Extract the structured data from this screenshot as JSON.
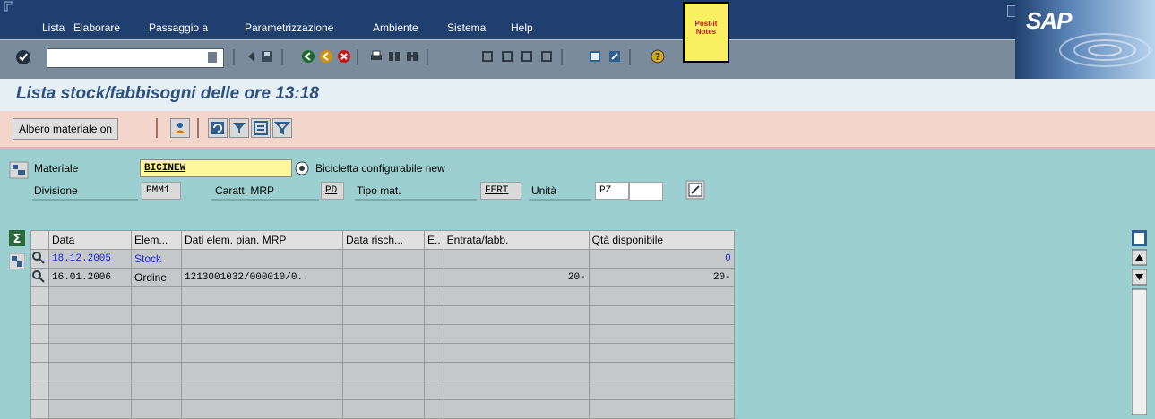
{
  "menu": {
    "items": [
      {
        "label": "Lista"
      },
      {
        "label": "Elaborare"
      },
      {
        "label": "Passaggio a"
      },
      {
        "label": "Parametrizzazione"
      },
      {
        "label": "Ambiente"
      },
      {
        "label": "Sistema"
      },
      {
        "label": "Help"
      }
    ]
  },
  "sap_logo_text": "SAP",
  "postit_label": "Post-it Notes",
  "page_title": "Lista stock/fabbisogni delle ore 13:18",
  "app_toolbar": {
    "albero_label": "Albero materiale on"
  },
  "header": {
    "materiale_label": "Materiale",
    "materiale_value": "BICINEW",
    "materiale_desc": "Bicicletta configurabile new",
    "divisione_label": "Divisione",
    "divisione_value": "PMM1",
    "caratt_label": "Caratt. MRP",
    "caratt_value": "PD",
    "tipo_label": "Tipo mat.",
    "tipo_value": "FERT",
    "unita_label": "Unità",
    "unita_value": "PZ"
  },
  "table": {
    "columns": [
      "Data",
      "Elem...",
      "Dati elem. pian. MRP",
      "Data risch...",
      "E..",
      "Entrata/fabb.",
      "Qtà disponibile"
    ],
    "rows": [
      {
        "data": "18.12.2005",
        "elem": "Stock",
        "dati": "",
        "data_risch": "",
        "e": "",
        "entrata": "",
        "qta": "0"
      },
      {
        "data": "16.01.2006",
        "elem": "Ordine",
        "dati": "1213001032/000010/0..",
        "data_risch": "",
        "e": "",
        "entrata": "20-",
        "qta": "20-"
      }
    ]
  },
  "colors": {
    "menubar": "#1f3f6f",
    "background": "#9ccfcf",
    "title": "#2b4f7f",
    "app_toolbar": "#f2d6cc",
    "input_highlight": "#fff59a"
  }
}
